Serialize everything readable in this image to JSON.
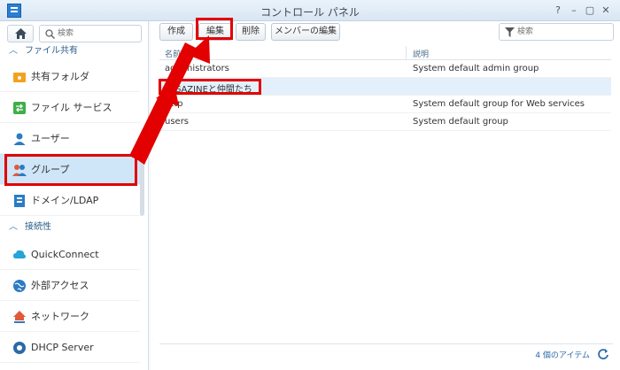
{
  "window": {
    "title": "コントロール パネル",
    "controls": [
      "?",
      "–",
      "▢",
      "✕"
    ]
  },
  "sidebar": {
    "search_placeholder": "検索",
    "sections": [
      {
        "label": "ファイル共有",
        "items": [
          {
            "label": "共有フォルダ",
            "icon": "shared-folder-icon"
          },
          {
            "label": "ファイル サービス",
            "icon": "file-service-icon"
          },
          {
            "label": "ユーザー",
            "icon": "user-icon"
          },
          {
            "label": "グループ",
            "icon": "group-icon",
            "active": true
          },
          {
            "label": "ドメイン/LDAP",
            "icon": "domain-icon"
          }
        ]
      },
      {
        "label": "接続性",
        "items": [
          {
            "label": "QuickConnect",
            "icon": "quickconnect-icon"
          },
          {
            "label": "外部アクセス",
            "icon": "external-access-icon"
          },
          {
            "label": "ネットワーク",
            "icon": "network-icon"
          },
          {
            "label": "DHCP Server",
            "icon": "dhcp-icon"
          }
        ]
      }
    ]
  },
  "toolbar": {
    "create_label": "作成",
    "edit_label": "編集",
    "delete_label": "削除",
    "member_edit_label": "メンバーの編集",
    "search_placeholder": "検索"
  },
  "grid": {
    "columns": [
      "名前",
      "説明"
    ],
    "rows": [
      {
        "name": "administrators",
        "description": "System default admin group"
      },
      {
        "name": "GIGAZINEと仲間たち",
        "description": "",
        "selected": true
      },
      {
        "name": "http",
        "description": "System default group for Web services"
      },
      {
        "name": "users",
        "description": "System default group"
      }
    ]
  },
  "footer": {
    "count_label": "4 個のアイテム"
  },
  "colors": {
    "accent": "#2a7ed4",
    "annotation": "#e20000",
    "selected_row": "#e3f0fb",
    "active_nav": "#cfe6f8"
  }
}
